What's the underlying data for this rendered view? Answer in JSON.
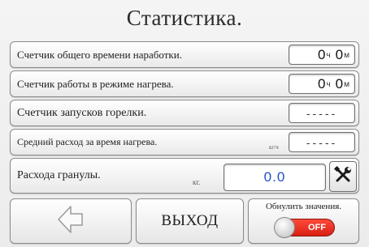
{
  "title": "Статистика.",
  "rows": [
    {
      "label": "Счетчик общего времени наработки.",
      "hours": "0",
      "hours_unit": "ч",
      "minutes": "0",
      "minutes_unit": "м"
    },
    {
      "label": "Счетчик работы в режиме нагрева.",
      "hours": "0",
      "hours_unit": "ч",
      "minutes": "0",
      "minutes_unit": "м"
    },
    {
      "label": "Счетчик запусков горелки.",
      "value": "-----"
    },
    {
      "label": "Средний расход за время нагрева.",
      "unit": "кг/ч",
      "value": "-----"
    }
  ],
  "granules": {
    "label": "Расхода гранулы.",
    "unit": "кг.",
    "value": "0.0",
    "value_color": "#1e50c8",
    "tool_icon": "wrench-screwdriver-icon"
  },
  "bottom": {
    "back_icon": "left-arrow-icon",
    "exit_label": "ВЫХОД",
    "reset_label": "Обнулить значения.",
    "toggle_state": "OFF",
    "toggle_color": "#e2281a"
  }
}
